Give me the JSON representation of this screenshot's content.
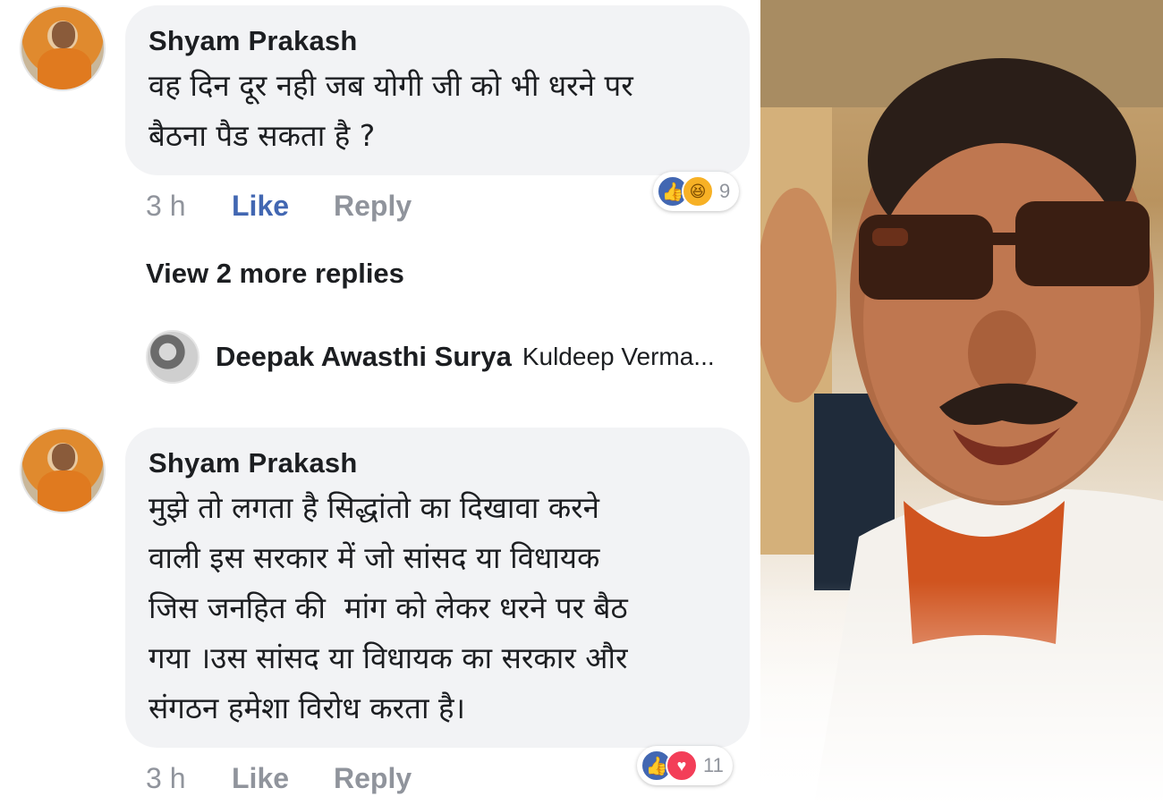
{
  "comments": [
    {
      "author": "Shyam Prakash",
      "text": "वह दिन दूर नही जब योगी जी को भी धरने पर\nबैठना पैड सकता है ?",
      "time": "3 h",
      "like_label": "Like",
      "reply_label": "Reply",
      "reaction_count": "9",
      "reactions": [
        "like-icon",
        "haha-icon"
      ]
    },
    {
      "author": "Shyam Prakash",
      "text": "मुझे तो लगता है सिद्धांतो का दिखावा करने\nवाली इस सरकार में जो सांसद या विधायक\nजिस जनहित की  मांग को लेकर धरने पर बैठ\nगया ।उस सांसद या विधायक का सरकार और\nसंगठन हमेशा विरोध करता है।",
      "time": "3 h",
      "like_label": "Like",
      "reply_label": "Reply",
      "reaction_count": "11",
      "reactions": [
        "like-icon",
        "love-icon"
      ]
    }
  ],
  "more_replies_label": "View 2 more replies",
  "reply_preview": {
    "name": "Deepak Awasthi Surya",
    "text": "Kuldeep Verma..."
  },
  "colors": {
    "bubble": "#f2f3f5",
    "like_active": "#4267b2",
    "meta_grey": "#90949c",
    "haha": "#f7b125",
    "love": "#f33e58"
  }
}
